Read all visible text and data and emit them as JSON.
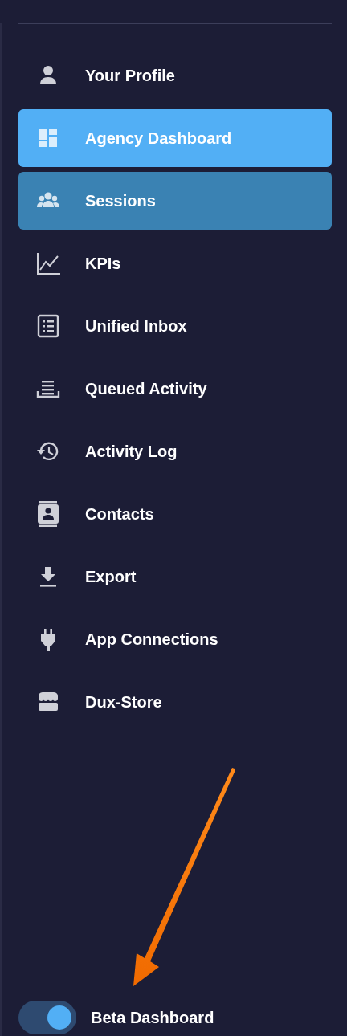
{
  "menu": [
    {
      "label": "Your Profile",
      "selected": false,
      "hovered": false
    },
    {
      "label": "Agency Dashboard",
      "selected": true,
      "hovered": false
    },
    {
      "label": "Sessions",
      "selected": false,
      "hovered": true
    },
    {
      "label": "KPIs",
      "selected": false,
      "hovered": false
    },
    {
      "label": "Unified Inbox",
      "selected": false,
      "hovered": false
    },
    {
      "label": "Queued Activity",
      "selected": false,
      "hovered": false
    },
    {
      "label": "Activity Log",
      "selected": false,
      "hovered": false
    },
    {
      "label": "Contacts",
      "selected": false,
      "hovered": false
    },
    {
      "label": "Export",
      "selected": false,
      "hovered": false
    },
    {
      "label": "App Connections",
      "selected": false,
      "hovered": false
    },
    {
      "label": "Dux-Store",
      "selected": false,
      "hovered": false
    }
  ],
  "beta_toggle": {
    "label": "Beta Dashboard",
    "on": true
  }
}
